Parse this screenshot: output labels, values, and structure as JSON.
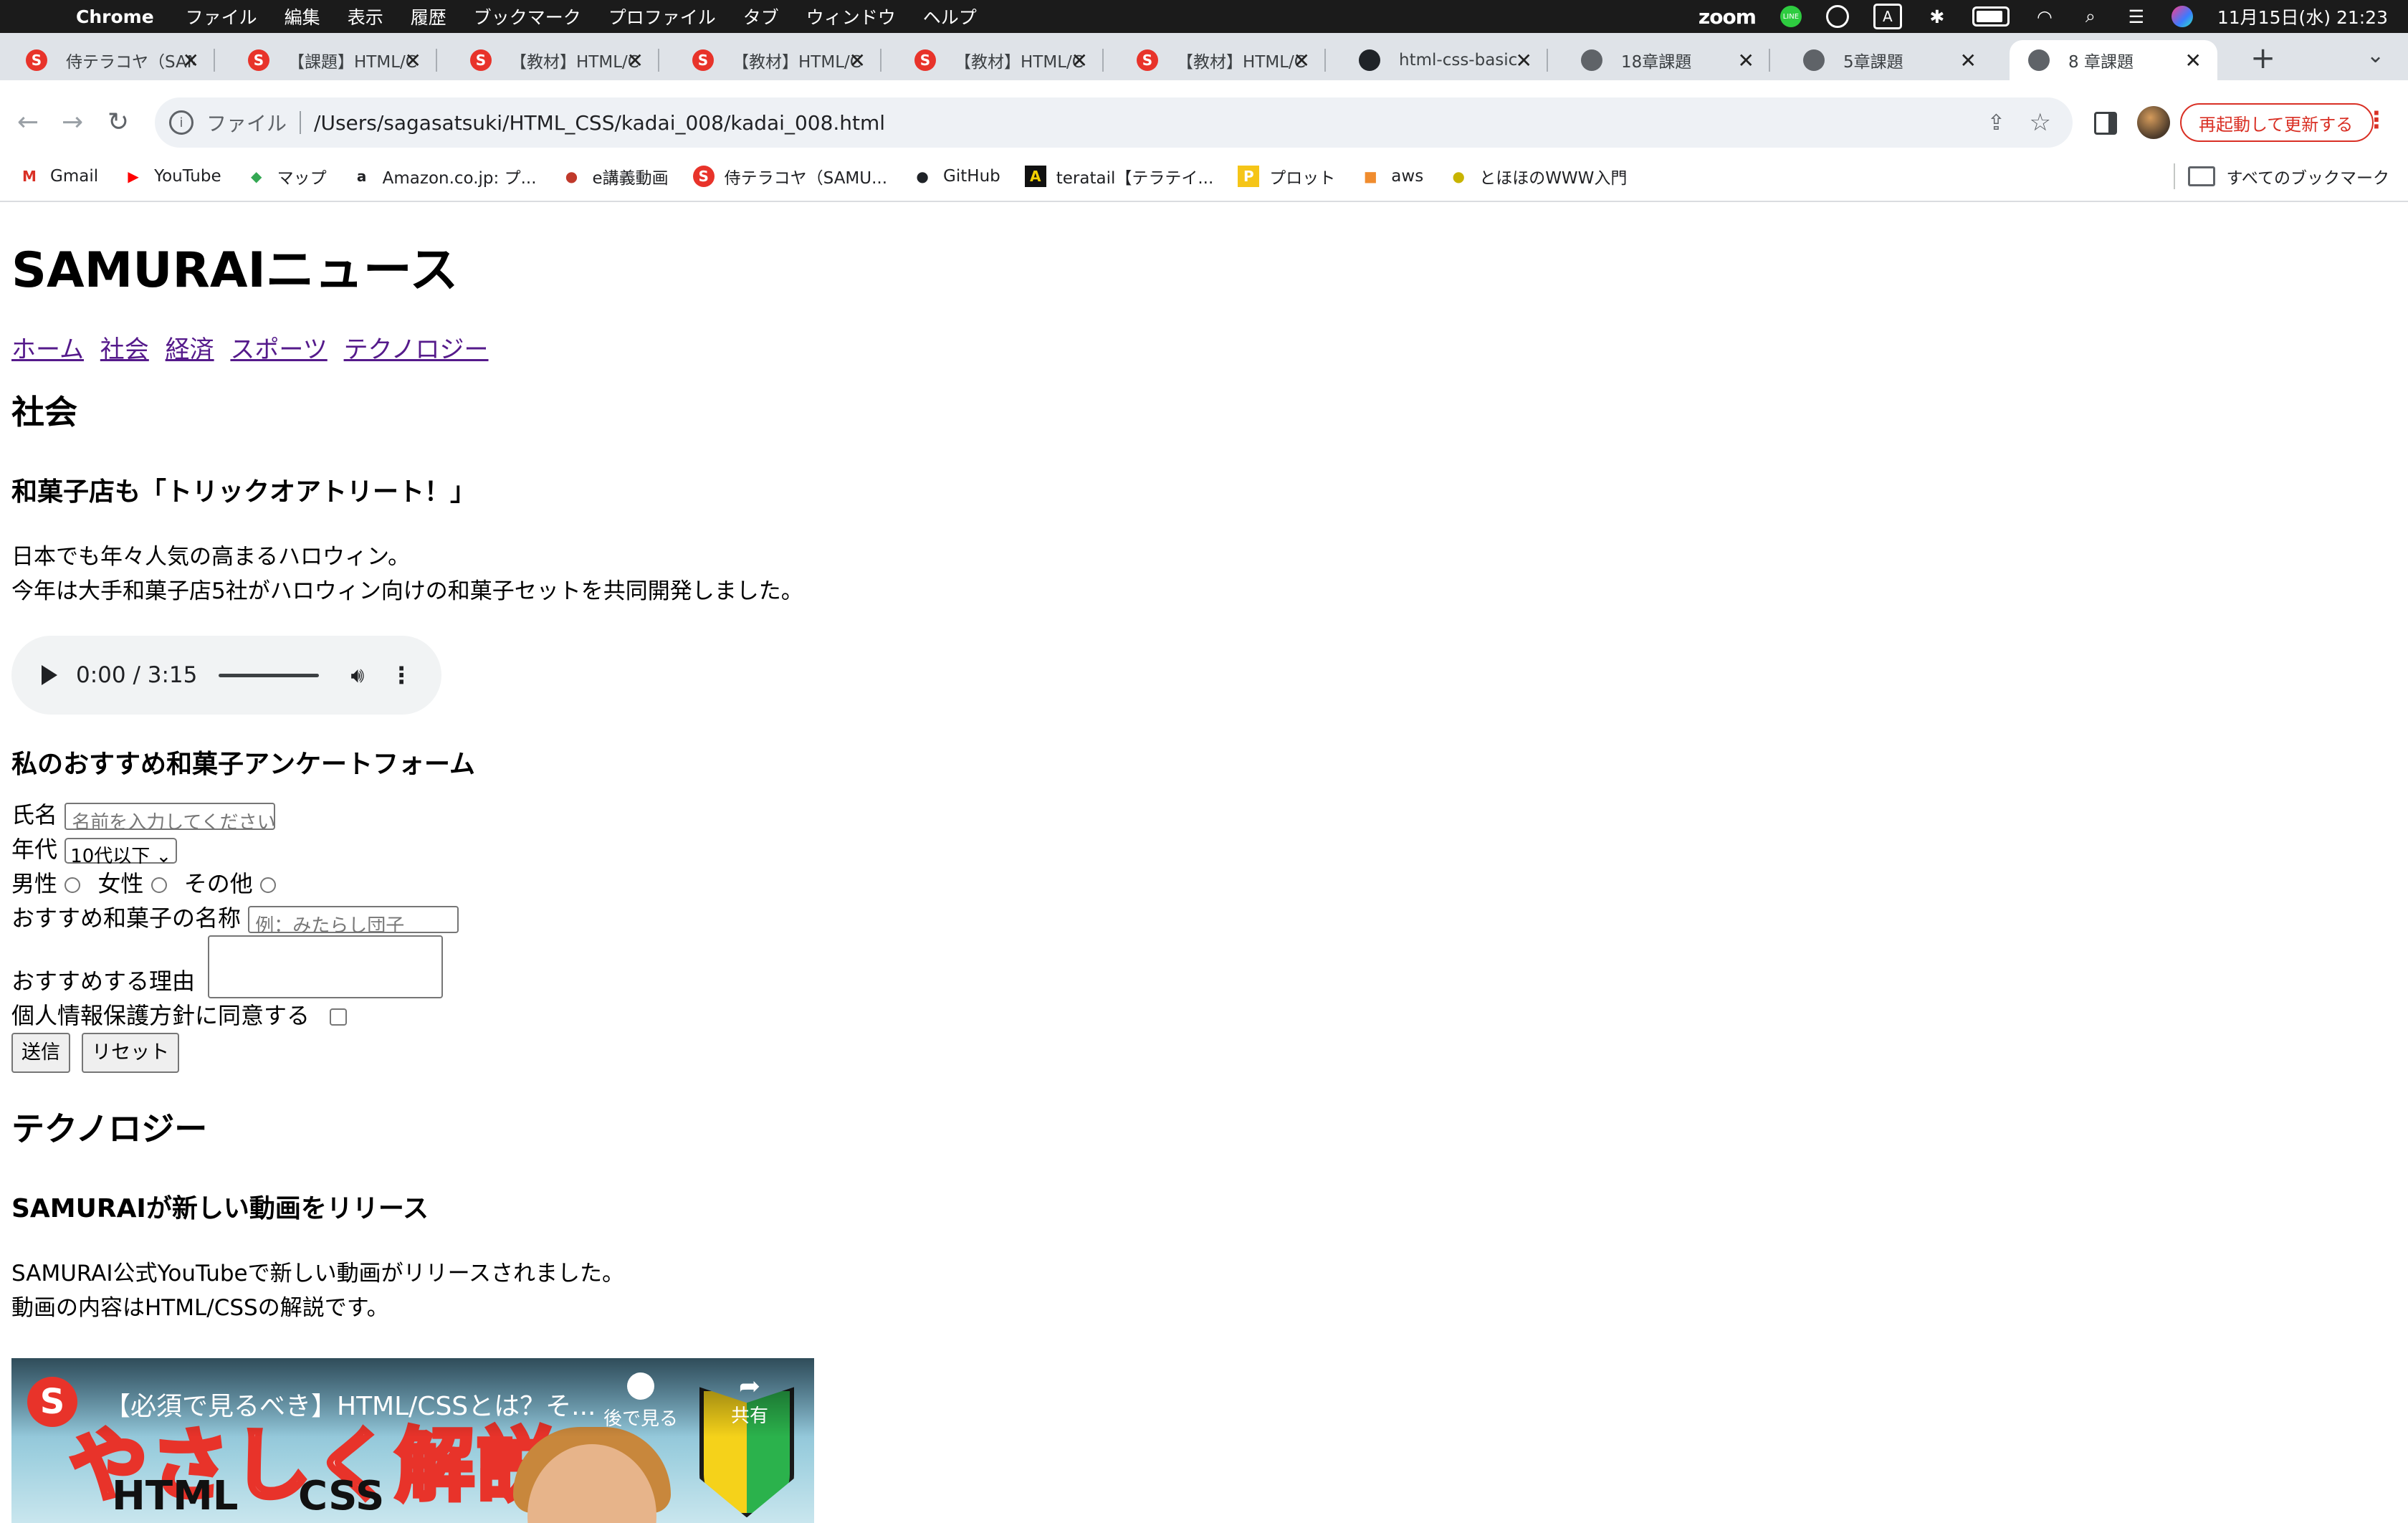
{
  "menubar": {
    "app": "Chrome",
    "items": [
      "ファイル",
      "編集",
      "表示",
      "履歴",
      "ブックマーク",
      "プロファイル",
      "タブ",
      "ウィンドウ",
      "ヘルプ"
    ],
    "zoom": "zoom",
    "line_icon": "LINE",
    "input_mode": "A",
    "datetime": "11月15日(水) 21:23"
  },
  "tabs": [
    {
      "label": "侍テラコヤ（SAMURAI",
      "icon": "samurai-icon"
    },
    {
      "label": "【課題】HTML/CSS",
      "icon": "samurai-icon"
    },
    {
      "label": "【教材】HTML/CSS",
      "icon": "samurai-icon"
    },
    {
      "label": "【教材】HTML/CSS",
      "icon": "samurai-icon"
    },
    {
      "label": "【教材】HTML/CSS",
      "icon": "samurai-icon"
    },
    {
      "label": "【教材】HTML/CSS",
      "icon": "samurai-icon"
    },
    {
      "label": "html-css-basic",
      "icon": "github-icon"
    },
    {
      "label": "18章課題",
      "icon": "globe-icon"
    },
    {
      "label": "5章課題",
      "icon": "globe-icon"
    },
    {
      "label": "8 章課題",
      "icon": "globe-icon",
      "active": true
    }
  ],
  "toolbar": {
    "scheme": "ファイル",
    "url": "/Users/sagasatsuki/HTML_CSS/kadai_008/kadai_008.html",
    "update_label": "再起動して更新する"
  },
  "bookmarks": [
    {
      "label": "Gmail",
      "icon": "gmail-icon",
      "glyph": "M",
      "color": "#d93025"
    },
    {
      "label": "YouTube",
      "icon": "youtube-icon",
      "glyph": "▶",
      "color": "#ff0000"
    },
    {
      "label": "マップ",
      "icon": "maps-icon",
      "glyph": "◆",
      "color": "#34a853"
    },
    {
      "label": "Amazon.co.jp: プ...",
      "icon": "amazon-icon",
      "glyph": "a",
      "color": "#111111"
    },
    {
      "label": "e講義動画",
      "icon": "electure-icon",
      "glyph": "●",
      "color": "#c0392b"
    },
    {
      "label": "侍テラコヤ（SAMU...",
      "icon": "samurai-icon",
      "glyph": "S",
      "color": "#e8332a"
    },
    {
      "label": "GitHub",
      "icon": "github-icon",
      "glyph": "●",
      "color": "#1f2328"
    },
    {
      "label": "teratail【テラテイ...",
      "icon": "teratail-icon",
      "glyph": "A",
      "color": "#111111"
    },
    {
      "label": "プロット",
      "icon": "plot-icon",
      "glyph": "P",
      "color": "#f5c518"
    },
    {
      "label": "aws",
      "icon": "aws-icon",
      "glyph": "■",
      "color": "#f08c2e"
    },
    {
      "label": "とほほのWWW入門",
      "icon": "tohoho-icon",
      "glyph": "●",
      "color": "#c8b400"
    }
  ],
  "bookmarks_all": "すべてのブックマーク",
  "page": {
    "site_title": "SAMURAIニュース",
    "nav": [
      "ホーム",
      "社会",
      "経済",
      "スポーツ",
      "テクノロジー"
    ],
    "section1": {
      "heading": "社会",
      "article_title": "和菓子店も「トリックオアトリート！」",
      "line1": "日本でも年々人気の高まるハロウィン。",
      "line2": "今年は大手和菓子店5社がハロウィン向けの和菓子セットを共同開発しました。"
    },
    "audio": {
      "time": "0:00 / 3:15"
    },
    "form": {
      "title": "私のおすすめ和菓子アンケートフォーム",
      "name_label": "氏名",
      "name_placeholder": "名前を入力してください",
      "age_label": "年代",
      "age_selected": "10代以下",
      "gender_options": [
        "男性",
        "女性",
        "その他"
      ],
      "sweet_label": "おすすめ和菓子の名称",
      "sweet_placeholder": "例：みたらし団子",
      "reason_label": "おすすめする理由",
      "agree_label": "個人情報保護方針に同意する",
      "submit": "送信",
      "reset": "リセット"
    },
    "section2": {
      "heading": "テクノロジー",
      "article_title": "SAMURAIが新しい動画をリリース",
      "line1": "SAMURAI公式YouTubeで新しい動画がリリースされました。",
      "line2": "動画の内容はHTML/CSSの解説です。"
    },
    "video": {
      "title": "【必須で見るべき】HTML/CSSとは？そ...",
      "thumb_text": "やさしく解説",
      "thumb_html": "HTML",
      "thumb_css": "CSS",
      "watch_later": "後で見る",
      "share": "共有"
    }
  }
}
